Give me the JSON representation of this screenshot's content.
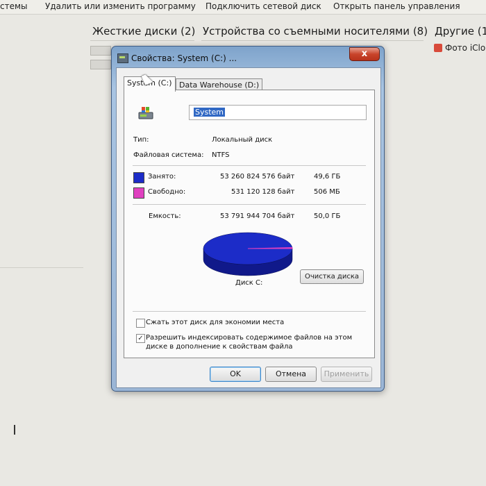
{
  "explorer": {
    "toolbar": [
      "стемы",
      "Удалить или изменить программу",
      "Подключить сетевой диск",
      "Открыть панель управления"
    ],
    "groups": [
      "Жесткие диски (2)",
      "Устройства со съемными носителями (8)",
      "Другие (1"
    ],
    "other_item": "Фото iClo"
  },
  "dialog": {
    "title": "Свойства: System (C:) ...",
    "close_label": "x",
    "tabs": [
      "System (C:)",
      "Data Warehouse (D:)"
    ],
    "volume_name": "System",
    "type_label": "Тип:",
    "type_value": "Локальный диск",
    "fs_label": "Файловая система:",
    "fs_value": "NTFS",
    "used": {
      "label": "Занято:",
      "bytes": "53 260 824 576 байт",
      "size": "49,6 ГБ",
      "color": "#1c2cc8"
    },
    "free": {
      "label": "Свободно:",
      "bytes": "531 120 128 байт",
      "size": "506 МБ",
      "color": "#e040c0"
    },
    "capacity": {
      "label": "Емкость:",
      "bytes": "53 791 944 704 байт",
      "size": "50,0 ГБ"
    },
    "disk_label": "Диск C:",
    "cleanup_button": "Очистка диска",
    "compress_label": "Сжать этот диск для экономии места",
    "compress_checked": false,
    "index_label": "Разрешить индексировать содержимое файлов на этом диске в дополнение к свойствам файла",
    "index_checked": true,
    "buttons": {
      "ok": "OK",
      "cancel": "Отмена",
      "apply": "Применить"
    }
  },
  "chart_data": {
    "type": "pie",
    "categories": [
      "Занято",
      "Свободно"
    ],
    "values": [
      53260824576,
      531120128
    ],
    "colors": [
      "#1c2cc8",
      "#e040c0"
    ]
  }
}
